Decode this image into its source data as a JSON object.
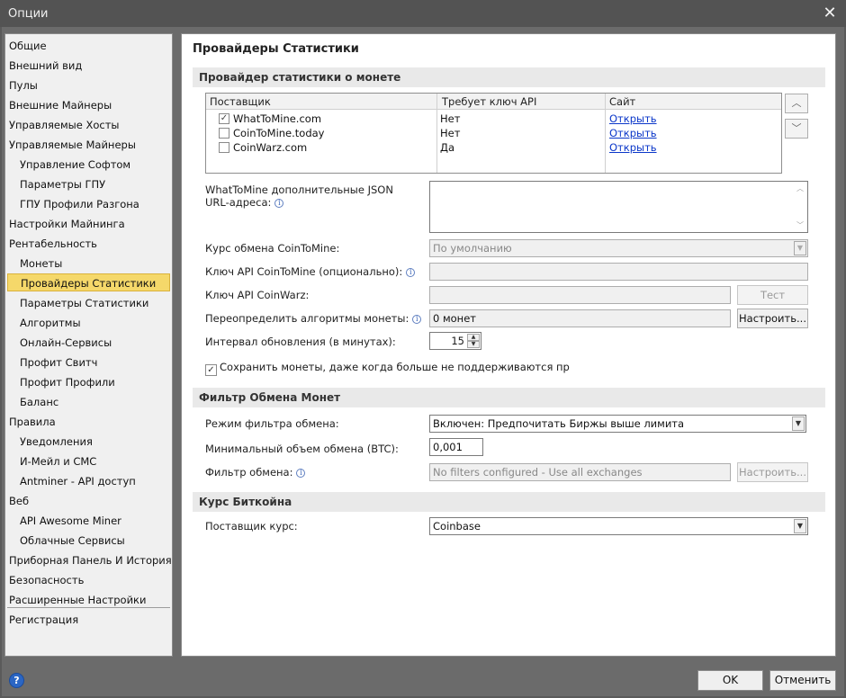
{
  "window": {
    "title": "Опции",
    "close_glyph": "✕"
  },
  "nav": {
    "items": [
      {
        "label": "Общие",
        "level": 0
      },
      {
        "label": "Внешний вид",
        "level": 0
      },
      {
        "label": "Пулы",
        "level": 0
      },
      {
        "label": "Внешние Майнеры",
        "level": 0
      },
      {
        "label": "Управляемые Хосты",
        "level": 0
      },
      {
        "label": "Управляемые Майнеры",
        "level": 0
      },
      {
        "label": "Управление Софтом",
        "level": 1
      },
      {
        "label": "Параметры ГПУ",
        "level": 1
      },
      {
        "label": "ГПУ Профили Разгона",
        "level": 1
      },
      {
        "label": "Настройки Майнинга",
        "level": 0
      },
      {
        "label": "Рентабельность",
        "level": 0
      },
      {
        "label": "Монеты",
        "level": 1
      },
      {
        "label": "Провайдеры Статистики",
        "level": 1,
        "selected": true
      },
      {
        "label": "Параметры Статистики",
        "level": 1
      },
      {
        "label": "Алгоритмы",
        "level": 1
      },
      {
        "label": "Онлайн-Сервисы",
        "level": 1
      },
      {
        "label": "Профит Свитч",
        "level": 1
      },
      {
        "label": "Профит Профили",
        "level": 1
      },
      {
        "label": "Баланс",
        "level": 1
      },
      {
        "label": "Правила",
        "level": 0
      },
      {
        "label": "Уведомления",
        "level": 1
      },
      {
        "label": "И-Мейл и СМС",
        "level": 1
      },
      {
        "label": "Antminer - API доступ",
        "level": 1
      },
      {
        "label": "Веб",
        "level": 0
      },
      {
        "label": "API Awesome Miner",
        "level": 1
      },
      {
        "label": "Облачные Сервисы",
        "level": 1
      },
      {
        "label": "Приборная Панель И История",
        "level": 0
      },
      {
        "label": "Безопасность",
        "level": 0
      },
      {
        "label": "Расширенные Настройки",
        "level": 0
      },
      {
        "label": "Регистрация",
        "level": 0
      }
    ]
  },
  "page": {
    "title": "Провайдеры Статистики",
    "coin_section": {
      "title": "Провайдер статистики о монете",
      "columns": [
        "Поставщик",
        "Требует ключ API",
        "Сайт"
      ],
      "rows": [
        {
          "name": "WhatToMine.com",
          "checked": true,
          "requires_key": "Нет",
          "site": "Открыть"
        },
        {
          "name": "CoinToMine.today",
          "checked": false,
          "requires_key": "Нет",
          "site": "Открыть"
        },
        {
          "name": "CoinWarz.com",
          "checked": false,
          "requires_key": "Да",
          "site": "Открыть"
        }
      ],
      "move_up_glyph": "︿",
      "move_down_glyph": "﹀",
      "json_urls_label_line1": "WhatToMine дополнительные JSON",
      "json_urls_label_line2": "URL-адреса:",
      "json_urls_value": "",
      "rate_label": "Курс обмена CoinToMine:",
      "rate_value": "По умолчанию",
      "ctm_key_label": "Ключ API CoinToMine (опционально):",
      "ctm_key_value": "",
      "cw_key_label": "Ключ API CoinWarz:",
      "cw_key_value": "",
      "test_button": "Тест",
      "override_label": "Переопределить  алгоритмы монеты:",
      "override_value": "0 монет",
      "configure_button": "Настроить...",
      "interval_label": "Интервал обновления (в минутах):",
      "interval_value": "15",
      "keep_coins_label": "Сохранить монеты, даже когда больше не поддерживаются пр",
      "keep_coins_checked": true
    },
    "exchange_section": {
      "title": "Фильтр Обмена Монет",
      "mode_label": "Режим фильтра обмена:",
      "mode_value": "Включен: Предпочитать Биржы выше лимита",
      "min_volume_label": "Минимальный объем обмена (BTC):",
      "min_volume_value": "0,001",
      "filter_label": "Фильтр обмена:",
      "filter_value": "No filters configured - Use all exchanges",
      "configure_button": "Настроить..."
    },
    "bitcoin_section": {
      "title": "Курс Биткойна",
      "provider_label": "Поставщик курс:",
      "provider_value": "Coinbase"
    }
  },
  "footer": {
    "help_glyph": "?",
    "ok_button": "OK",
    "cancel_button": "Отменить"
  },
  "icons": {
    "info": "i",
    "check": "✓",
    "dropdown": "▼",
    "spin_up": "▲",
    "spin_down": "▼",
    "scroll_up": "︿",
    "scroll_down": "﹀"
  },
  "colors": {
    "selected_bg": "#f5d86a",
    "link": "#0b37c9",
    "help": "#2b66c4"
  }
}
